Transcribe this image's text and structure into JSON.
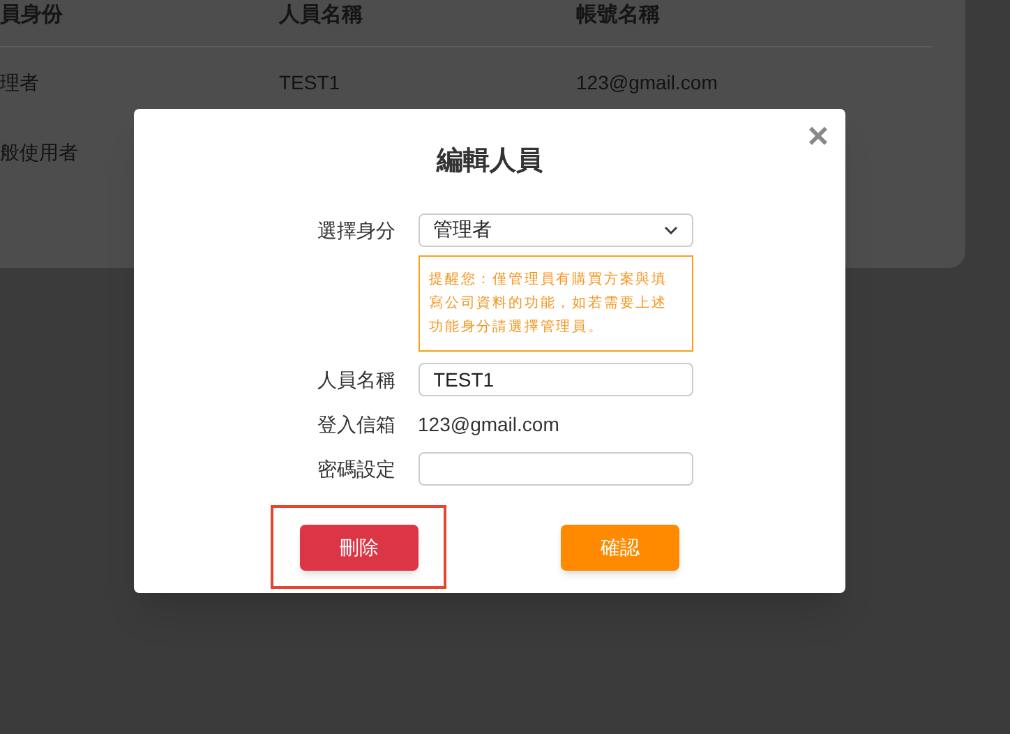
{
  "table": {
    "columns": [
      "員身份",
      "人員名稱",
      "帳號名稱"
    ],
    "rows": [
      {
        "cells": [
          "理者",
          "TEST1",
          "123@gmail.com"
        ]
      },
      {
        "cells": [
          "般使用者"
        ]
      }
    ]
  },
  "dialog": {
    "title": "編輯人員",
    "close": "×",
    "fields": [
      {
        "kind": "select",
        "label": "選擇身分",
        "value": "管理者",
        "notice": "提醒您：僅管理員有購買方案與填寫公司資料的功能，如若需要上述功能身分請選擇管理員。"
      },
      {
        "kind": "input",
        "label": "人員名稱",
        "value": "TEST1"
      },
      {
        "kind": "text",
        "label": "登入信箱",
        "value": "123@gmail.com"
      },
      {
        "kind": "input",
        "label": "密碼設定"
      }
    ],
    "buttons": [
      {
        "kind": "delete",
        "label": "刪除",
        "highlighted": true
      },
      {
        "kind": "confirm",
        "label": "確認",
        "highlighted": false
      }
    ]
  }
}
